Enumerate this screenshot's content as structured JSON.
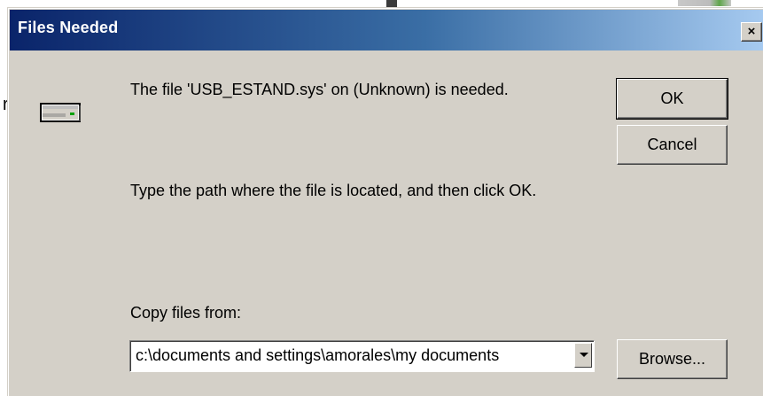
{
  "background": {
    "char": "r"
  },
  "dialog": {
    "title": "Files Needed",
    "close_label": "×",
    "message": "The file 'USB_ESTAND.sys' on (Unknown) is needed.",
    "instruction": "Type the path where the file is located, and then click OK.",
    "copy_from_label": "Copy files from:",
    "copy_from_value": "c:\\documents and settings\\amorales\\my documents",
    "buttons": {
      "ok": "OK",
      "cancel": "Cancel",
      "browse": "Browse..."
    }
  },
  "colors": {
    "titlebar_start": "#0a246a",
    "titlebar_end": "#a6caf0",
    "dialog_face": "#d4d0c8"
  },
  "icons": {
    "drive": "drive-icon",
    "dropdown": "chevron-down-icon"
  }
}
